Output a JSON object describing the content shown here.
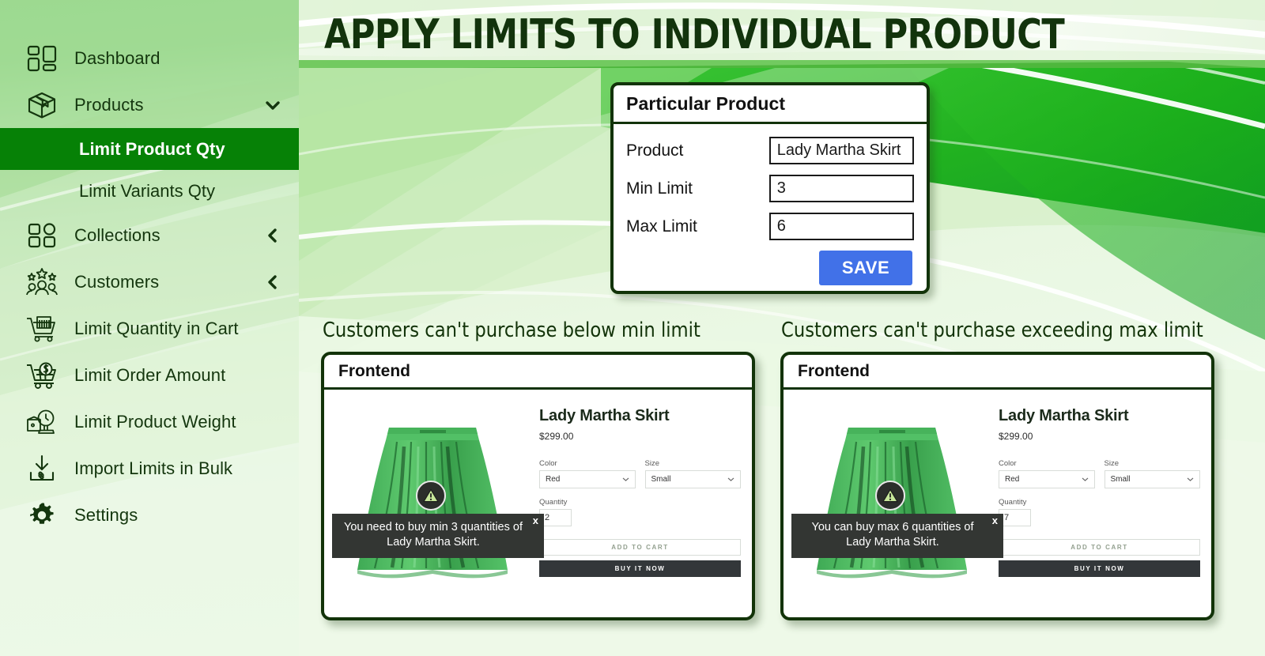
{
  "header": {
    "title": "APPLY LIMITS TO INDIVIDUAL PRODUCT"
  },
  "colors": {
    "accent_green": "#068106",
    "dark_green": "#123309",
    "save_blue": "#4171e8",
    "toast_dark": "#333633",
    "sidebar_text": "#14360e"
  },
  "sidebar": {
    "items": [
      {
        "label": "Dashboard",
        "icon": "dashboard-grid-icon",
        "chevron": null,
        "active": false
      },
      {
        "label": "Products",
        "icon": "box-package-icon",
        "chevron": "chevron-down-icon",
        "active": false
      },
      {
        "label": "Limit Product Qty",
        "icon": null,
        "chevron": null,
        "active": true,
        "sub": true
      },
      {
        "label": "Limit Variants Qty",
        "icon": null,
        "chevron": null,
        "active": false,
        "sub": true
      },
      {
        "label": "Collections",
        "icon": "collections-grid-icon",
        "chevron": "chevron-left-icon",
        "active": false
      },
      {
        "label": "Customers",
        "icon": "customers-stars-icon",
        "chevron": "chevron-left-icon",
        "active": false
      },
      {
        "label": "Limit Quantity in Cart",
        "icon": "shopping-cart-icon",
        "chevron": null,
        "active": false
      },
      {
        "label": "Limit Order Amount",
        "icon": "cart-dollar-icon",
        "chevron": null,
        "active": false
      },
      {
        "label": "Limit Product Weight",
        "icon": "product-weight-scale-icon",
        "chevron": null,
        "active": false
      },
      {
        "label": "Import Limits in Bulk",
        "icon": "import-download-icon",
        "chevron": null,
        "active": false
      },
      {
        "label": "Settings",
        "icon": "gear-icon",
        "chevron": null,
        "active": false
      }
    ]
  },
  "particular_product": {
    "card_title": "Particular Product",
    "fields": [
      {
        "label": "Product",
        "value": "Lady Martha Skirt"
      },
      {
        "label": "Min Limit",
        "value": "3"
      },
      {
        "label": "Max Limit",
        "value": "6"
      }
    ],
    "save_label": "SAVE"
  },
  "captions": {
    "left": "Customers can't purchase below min limit",
    "right": "Customers can't purchase exceeding max limit"
  },
  "frontends": [
    {
      "panel_title": "Frontend",
      "product_title": "Lady Martha Skirt",
      "price": "$299.00",
      "color_label": "Color",
      "color_value": "Red",
      "size_label": "Size",
      "size_value": "Small",
      "quantity_label": "Quantity",
      "quantity_value": "2",
      "add_to_cart_label": "ADD TO CART",
      "buy_it_now_label": "BUY IT NOW",
      "toast_message": "You need to buy min 3 quantities of Lady Martha Skirt.",
      "toast_close": "x"
    },
    {
      "panel_title": "Frontend",
      "product_title": "Lady Martha Skirt",
      "price": "$299.00",
      "color_label": "Color",
      "color_value": "Red",
      "size_label": "Size",
      "size_value": "Small",
      "quantity_label": "Quantity",
      "quantity_value": "7",
      "add_to_cart_label": "ADD TO CART",
      "buy_it_now_label": "BUY IT NOW",
      "toast_message": "You can buy max 6 quantities of Lady Martha Skirt.",
      "toast_close": "x"
    }
  ]
}
